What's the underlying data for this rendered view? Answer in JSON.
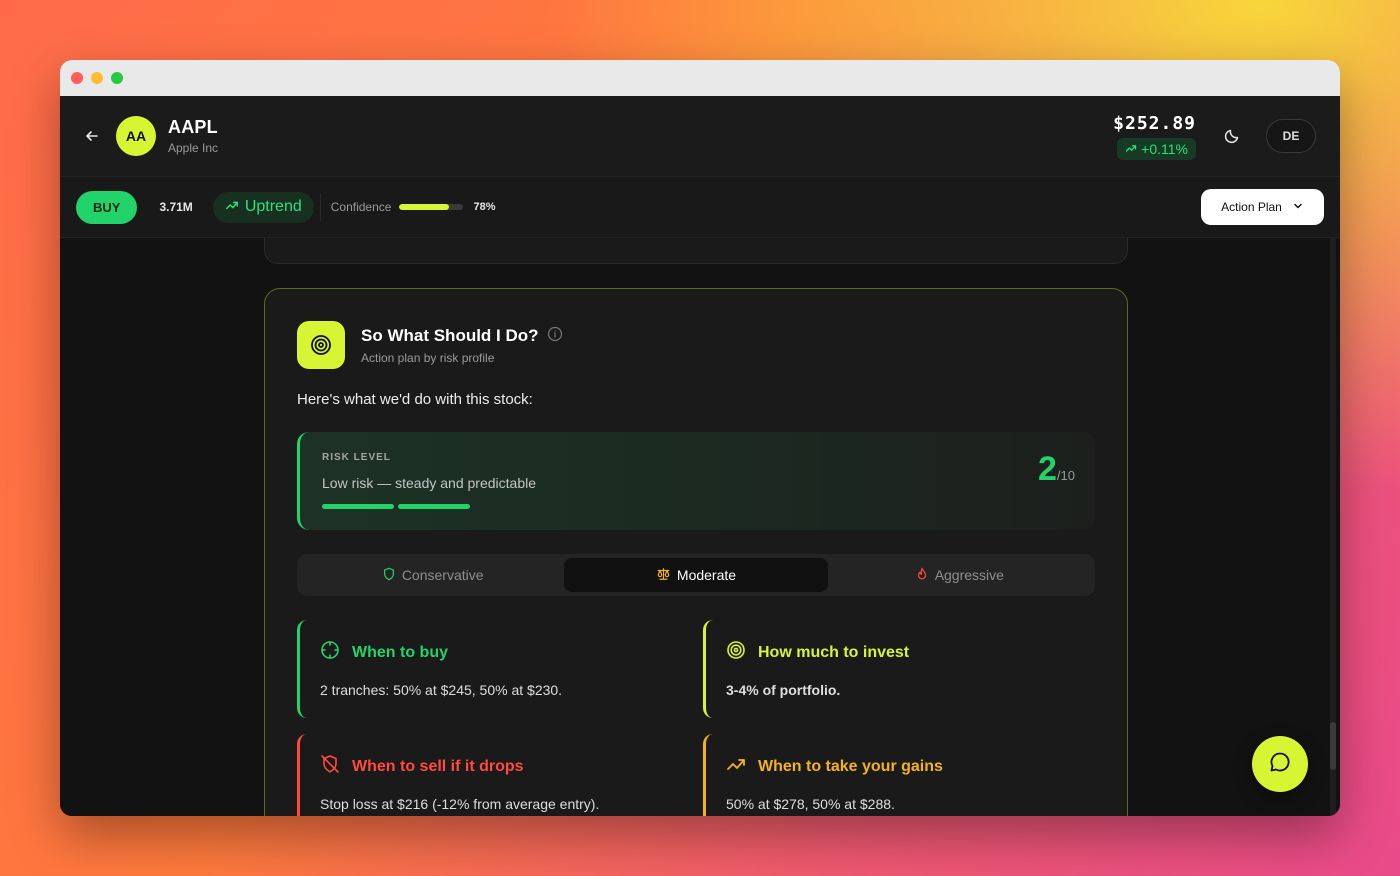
{
  "header": {
    "avatar_initials": "AA",
    "ticker": "AAPL",
    "company": "Apple Inc",
    "price": "$252.89",
    "change": "+0.11%",
    "language": "DE"
  },
  "subbar": {
    "signal": "BUY",
    "volume": "3.71M",
    "trend": "Uptrend",
    "confidence_label": "Confidence",
    "confidence_value": "78%",
    "confidence_fraction": 0.78,
    "section_select": "Action Plan"
  },
  "card": {
    "title": "So What Should I Do?",
    "subtitle": "Action plan by risk profile",
    "intro": "Here's what we'd do with this stock:",
    "risk": {
      "label": "RISK LEVEL",
      "description": "Low risk — steady and predictable",
      "score": "2",
      "max": "/10"
    },
    "tabs": [
      {
        "label": "Conservative",
        "icon": "shield-icon"
      },
      {
        "label": "Moderate",
        "icon": "scale-icon",
        "active": true
      },
      {
        "label": "Aggressive",
        "icon": "flame-icon"
      }
    ],
    "plan": [
      {
        "title": "When to buy",
        "text": "2 tranches: 50% at $245, 50% at $230.",
        "color": "#22d36a",
        "icon": "crosshair-icon"
      },
      {
        "title": "How much to invest",
        "text": "3-4% of portfolio.",
        "color": "#d7f532",
        "icon": "target-icon"
      },
      {
        "title": "When to sell if it drops",
        "text": "Stop loss at $216 (-12% from average entry).",
        "color": "#ff4a3d",
        "icon": "shield-off-icon"
      },
      {
        "title": "When to take your gains",
        "text": "50% at $278, 50% at $288.",
        "color": "#f5b318",
        "icon": "trending-up-icon"
      }
    ]
  },
  "colors": {
    "accent": "#d7f532",
    "positive": "#22d36a",
    "negative": "#ff4a3d",
    "warning": "#f5b318"
  }
}
